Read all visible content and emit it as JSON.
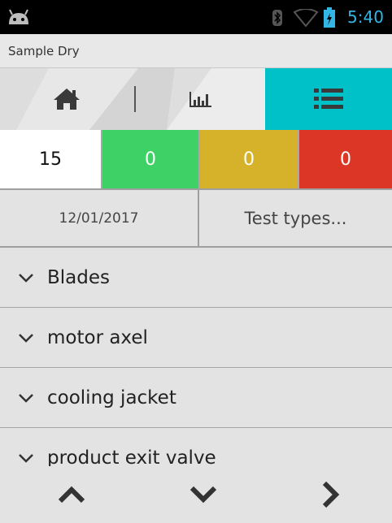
{
  "status_bar": {
    "time": "5:40",
    "icons": [
      "android-icon",
      "bluetooth-icon",
      "wifi-icon",
      "battery-charging-icon"
    ],
    "accent_color": "#33b5e5"
  },
  "app": {
    "title": "Sample Dry"
  },
  "nav_tabs": [
    {
      "icon": "home-icon",
      "active": false
    },
    {
      "icon": "bar-chart-icon",
      "active": false
    },
    {
      "icon": "list-icon",
      "active": true
    }
  ],
  "colors": {
    "active_tab": "#00c0c8",
    "green": "#3ed165",
    "yellow": "#d6b22b",
    "red": "#dc3726"
  },
  "counters": {
    "total": "15",
    "green": "0",
    "yellow": "0",
    "red": "0"
  },
  "filters": {
    "date": "12/01/2017",
    "test_types": "Test types..."
  },
  "list": {
    "items": [
      {
        "label": "Blades"
      },
      {
        "label": "motor axel"
      },
      {
        "label": "cooling jacket"
      },
      {
        "label": "product exit valve"
      }
    ]
  },
  "bottom_nav": {
    "icons": [
      "chevron-up-icon",
      "chevron-down-icon",
      "chevron-right-icon"
    ]
  }
}
